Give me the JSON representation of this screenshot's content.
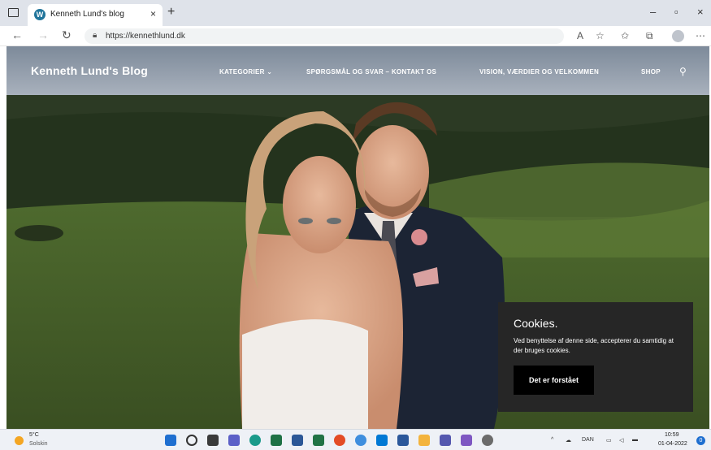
{
  "browser": {
    "tab_title": "Kenneth Lund's blog",
    "tab_close": "×",
    "new_tab": "+",
    "url": "https://kennethlund.dk",
    "favicon": "wordpress-icon",
    "window_minimize": "–",
    "window_restore": "▫",
    "window_close": "×",
    "more": "⋯"
  },
  "site": {
    "title": "Kenneth Lund's Blog",
    "nav": [
      {
        "label": "KATEGORIER",
        "has_dropdown": true
      },
      {
        "label": "SPØRGSMÅL OG SVAR – KONTAKT OS"
      },
      {
        "label": "VISION, VÆRDIER OG VELKOMMEN"
      },
      {
        "label": "SHOP"
      }
    ],
    "dropdown_caret": "⌄"
  },
  "cookie": {
    "title": "Cookies.",
    "text": "Ved benyttelse af denne side, accepterer du samtidig at der bruges cookies.",
    "button": "Det er forstået"
  },
  "taskbar": {
    "weather_temp": "5°C",
    "weather_desc": "Solskin",
    "language": "DAN",
    "time": "10:59",
    "date": "01-04-2022",
    "notification_count": "0"
  },
  "colors": {
    "cookie_bg": "#262626",
    "cookie_button": "#000000",
    "taskbar_bg": "#eef1f6"
  }
}
